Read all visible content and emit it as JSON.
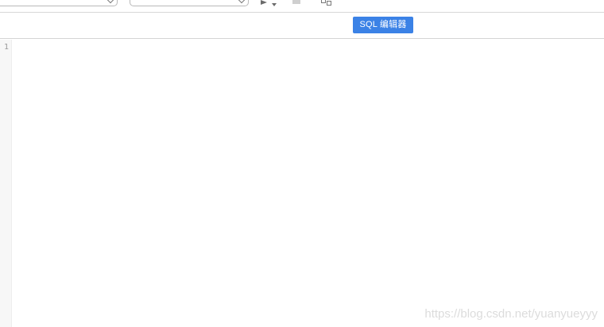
{
  "toolbar": {
    "database_select": {
      "value": ""
    },
    "schema_select": {
      "value": ""
    },
    "run": {
      "icon": "play-icon"
    },
    "stop": {
      "icon": "stop-icon"
    },
    "export": {
      "icon": "export-icon"
    }
  },
  "tabs": [
    {
      "label": "SQL 编辑器",
      "active": true
    }
  ],
  "editor": {
    "line_numbers": [
      "1"
    ],
    "content": ""
  },
  "watermark": "https://blog.csdn.net/yuanyueyyy",
  "colors": {
    "active_tab": "#3b82e6",
    "active_tab_text": "#ffffff",
    "border": "#d4d4d4",
    "gutter": "#f7f7f7"
  }
}
